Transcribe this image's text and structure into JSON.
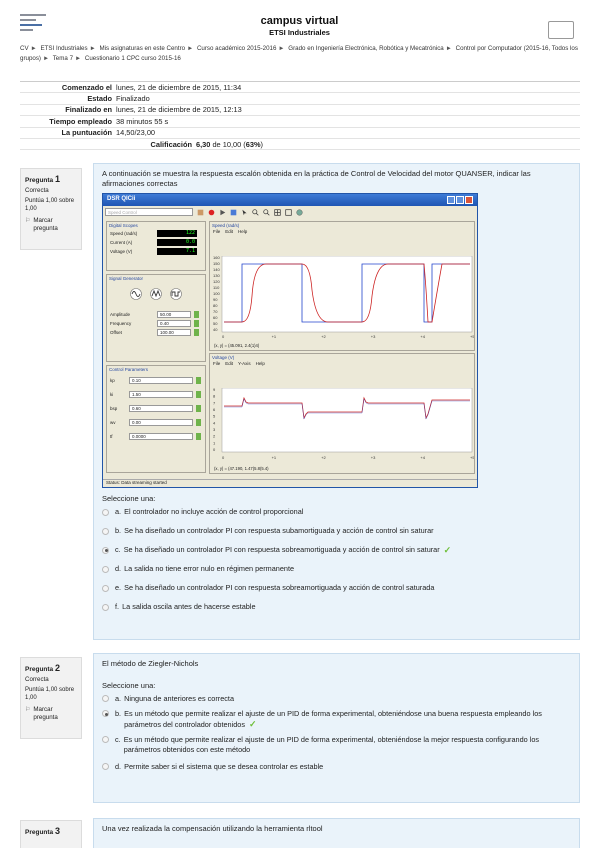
{
  "header": {
    "site_title": "campus virtual",
    "site_subtitle": "ETSI Industriales"
  },
  "breadcrumb": [
    "CV",
    "ETSI Industriales",
    "Mis asignaturas en este Centro",
    "Curso académico 2015-2016",
    "Grado en Ingeniería Electrónica, Robótica y Mecatrónica",
    "Control por Computador (2015-16, Todos los grupos)",
    "Tema 7",
    "Cuestionario 1 CPC curso 2015-16"
  ],
  "summary": [
    {
      "label": "Comenzado el",
      "value": "lunes, 21 de diciembre de 2015, 11:34"
    },
    {
      "label": "Estado",
      "value": "Finalizado"
    },
    {
      "label": "Finalizado en",
      "value": "lunes, 21 de diciembre de 2015, 12:13"
    },
    {
      "label": "Tiempo empleado",
      "value": "38 minutos 55 s"
    },
    {
      "label": "La puntuación",
      "value": "14,50/23,00"
    },
    {
      "label": "Calificación",
      "value_bold": "6,30",
      "value_rest": " de 10,00 (",
      "value_pct": "63%",
      "value_end": ")"
    }
  ],
  "questions": [
    {
      "label": "Pregunta",
      "number": "1",
      "state": "Correcta",
      "points": "Puntúa 1,00 sobre 1,00",
      "flag": "Marcar pregunta",
      "text": "A continuación se muestra la respuesta escalón obtenida en la práctica de Control de Velocidad del motor QUANSER, indicar las afirmaciones correctas",
      "select_label": "Seleccione una:",
      "answers": [
        {
          "letter": "a.",
          "text": "El controlador no incluye acción de control proporcional",
          "selected": false,
          "correct": false
        },
        {
          "letter": "b.",
          "text": "Se ha diseñado un controlador PI con respuesta subamortiguada y acción de control sin saturar",
          "selected": false,
          "correct": false
        },
        {
          "letter": "c.",
          "text": "Se ha diseñado un controlador PI con respuesta sobreamortiguada y acción de control sin saturar",
          "selected": true,
          "correct": true
        },
        {
          "letter": "d.",
          "text": "La salida no tiene error nulo en régimen permanente",
          "selected": false,
          "correct": false
        },
        {
          "letter": "e.",
          "text": "Se ha diseñado un controlador PI con respuesta sobreamortiguada y acción de control saturada",
          "selected": false,
          "correct": false
        },
        {
          "letter": "f.",
          "text": "La salida oscila antes de hacerse estable",
          "selected": false,
          "correct": false
        }
      ]
    },
    {
      "label": "Pregunta",
      "number": "2",
      "state": "Correcta",
      "points": "Puntúa 1,00 sobre 1,00",
      "flag": "Marcar pregunta",
      "text": "El método de Ziegler-Nichols",
      "select_label": "Seleccione una:",
      "answers": [
        {
          "letter": "a.",
          "text": "Ninguna de anteriores es correcta",
          "selected": false,
          "correct": false
        },
        {
          "letter": "b.",
          "text": "Es un método que permite realizar el ajuste de un PID de forma experimental, obteniéndose una buena respuesta empleando los parámetros del controlador obtenidos",
          "selected": true,
          "correct": true
        },
        {
          "letter": "c.",
          "text": "Es un método que permite realizar el ajuste de un PID de forma experimental, obteniéndose la mejor respuesta configurando los parámetros obtenidos con este método",
          "selected": false,
          "correct": false
        },
        {
          "letter": "d.",
          "text": "Permite saber si el sistema que se desea controlar es estable",
          "selected": false,
          "correct": false
        }
      ]
    },
    {
      "label": "Pregunta",
      "number": "3",
      "text": "Una vez realizada la compensación utilizando la herramienta rltool"
    }
  ],
  "screenshot": {
    "window_title": "DSR QICii",
    "digital_scopes": "Digital Scopes",
    "speed_label": "Speed (rad/s)",
    "speed_value": "122",
    "current_label": "Current (A)",
    "current_value": "0.0",
    "voltage_label": "Voltage (V)",
    "voltage_value": "7.1",
    "signal_generator": "Signal Generator",
    "amplitude_label": "Amplitude",
    "amplitude_value": "50.00",
    "frequency_label": "Frequency",
    "frequency_value": "0.40",
    "offset_label": "Offset",
    "offset_value": "100.00",
    "control_parameters": "Control Parameters",
    "params": [
      {
        "name": "kp",
        "value": "0.10"
      },
      {
        "name": "ki",
        "value": "1.50"
      },
      {
        "name": "bsp",
        "value": "0.60"
      },
      {
        "name": "wv",
        "value": "0.00"
      },
      {
        "name": "tf",
        "value": "0.0000"
      }
    ],
    "speed_plot_title": "Speed (rad/s)",
    "voltage_plot_title": "Voltage (V)",
    "menu1": [
      "File",
      "Edit",
      "Help"
    ],
    "menu2": [
      "File",
      "Edit",
      "Y-Axis",
      "Help"
    ],
    "speed_readout": "(x, y) = (45.091, 2.4(1)4)",
    "voltage_readout": "(x, y) = (47.190, 1.47(5.8(5.4)",
    "status": "Status: Data streaming started",
    "speed_yticks": [
      "160",
      "150",
      "140",
      "130",
      "120",
      "110",
      "100",
      "90",
      "80",
      "70",
      "60",
      "50",
      "40"
    ],
    "voltage_yticks": [
      "9",
      "8",
      "7",
      "6",
      "5",
      "4",
      "3",
      "2",
      "1",
      "0"
    ],
    "xticks": [
      "0",
      "+1",
      "+2",
      "+3",
      "+4",
      "+5"
    ]
  }
}
